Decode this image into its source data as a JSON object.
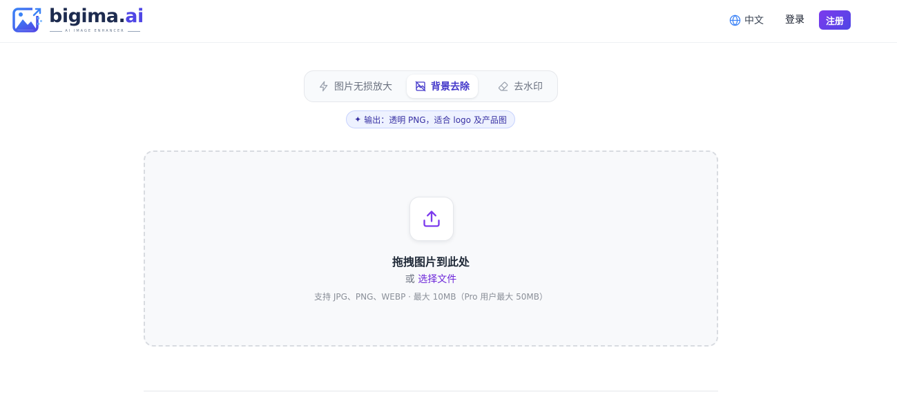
{
  "brand": {
    "name_main": "bigima.",
    "name_accent": "ai",
    "tagline": "AI IMAGE ENHANCER",
    "primary_color": "#4f46e5",
    "accent_color": "#7c3aed"
  },
  "header": {
    "language_label": "中文",
    "login_label": "登录",
    "signup_label": "注册"
  },
  "tabs": [
    {
      "label": "图片无损放大",
      "icon": "bolt-icon",
      "active": false
    },
    {
      "label": "背景去除",
      "icon": "image-off-icon",
      "active": true
    },
    {
      "label": "去水印",
      "icon": "eraser-icon",
      "active": false
    }
  ],
  "hint": {
    "icon": "✦",
    "text": "输出：透明 PNG，适合 logo 及产品图"
  },
  "upload": {
    "title": "拖拽图片到此处",
    "or_text": "或",
    "choose_file": "选择文件",
    "note": "支持 JPG、PNG、WEBP · 最大 10MB（Pro 用户最大 50MB）"
  }
}
